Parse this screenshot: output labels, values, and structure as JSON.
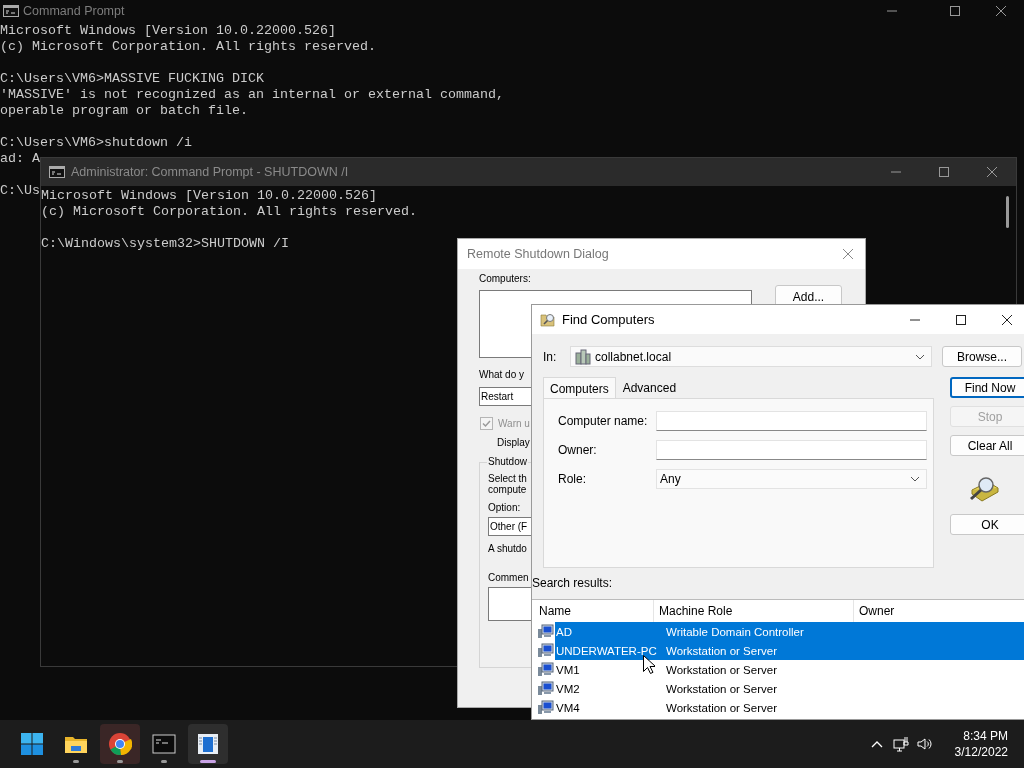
{
  "background_window": {
    "title": "Command Prompt",
    "blocks": [
      [
        "Microsoft Windows [Version 10.0.22000.526]",
        "(c) Microsoft Corporation. All rights reserved."
      ],
      [
        "C:\\Users\\VM6>MASSIVE FUCKING DICK",
        "'MASSIVE' is not recognized as an internal or external command,",
        "operable program or batch file."
      ],
      [
        "C:\\Users\\VM6>shutdown /i",
        "ad: A"
      ],
      [
        "C:\\Us"
      ]
    ]
  },
  "admin_window": {
    "title": "Administrator: Command Prompt - SHUTDOWN  /I",
    "blocks": [
      [
        "Microsoft Windows [Version 10.0.22000.526]",
        "(c) Microsoft Corporation. All rights reserved."
      ],
      [
        "C:\\Windows\\system32>SHUTDOWN /I"
      ]
    ]
  },
  "remote_shutdown_dialog": {
    "title": "Remote Shutdown Dialog",
    "computers_label": "Computers:",
    "add_button": "Add...",
    "action_label": "What do y",
    "action_value": "Restart",
    "warn": {
      "label": "Warn u",
      "checked": true,
      "disabled": true
    },
    "display_label": "Display",
    "group_title": "Shutdow",
    "group_lines": [
      "Select th",
      "compute"
    ],
    "option_label": "Option:",
    "option_value": "Other (F",
    "note": "A shutdo",
    "comment_label": "Commen"
  },
  "find_computers": {
    "title": "Find Computers",
    "in_label": "In:",
    "in_value": "collabnet.local",
    "browse_button": "Browse...",
    "tabs": [
      {
        "label": "Computers",
        "selected": true
      },
      {
        "label": "Advanced",
        "selected": false
      }
    ],
    "fields": [
      {
        "kind": "text",
        "label": "Computer name:"
      },
      {
        "kind": "text",
        "label": "Owner:"
      },
      {
        "kind": "select",
        "label": "Role:",
        "value": "Any"
      }
    ],
    "buttons": [
      {
        "label": "Find Now",
        "default": true,
        "disabled": false
      },
      {
        "label": "Stop",
        "default": false,
        "disabled": true
      },
      {
        "label": "Clear All",
        "default": false,
        "disabled": false
      }
    ],
    "ok_button": "OK",
    "results_label": "Search results:",
    "columns": [
      "Name",
      "Machine Role",
      "Owner"
    ],
    "rows": [
      {
        "name": "AD",
        "role": "Writable Domain Controller",
        "selected": true
      },
      {
        "name": "UNDERWATER-PC",
        "role": "Workstation or Server",
        "selected": true
      },
      {
        "name": "VM1",
        "role": "Workstation or Server",
        "selected": false
      },
      {
        "name": "VM2",
        "role": "Workstation or Server",
        "selected": false
      },
      {
        "name": "VM4",
        "role": "Workstation or Server",
        "selected": false
      }
    ]
  },
  "taskbar": {
    "items": [
      {
        "kind": "start",
        "running": false,
        "selected": false,
        "hovered": false
      },
      {
        "kind": "folder",
        "running": true,
        "selected": false,
        "hovered": false
      },
      {
        "kind": "browser",
        "running": true,
        "selected": false,
        "hovered": true
      },
      {
        "kind": "terminal",
        "running": true,
        "selected": false,
        "hovered": false
      },
      {
        "kind": "app",
        "running": true,
        "selected": true,
        "hovered": false
      }
    ],
    "time": "8:34 PM",
    "date": "3/12/2022"
  }
}
